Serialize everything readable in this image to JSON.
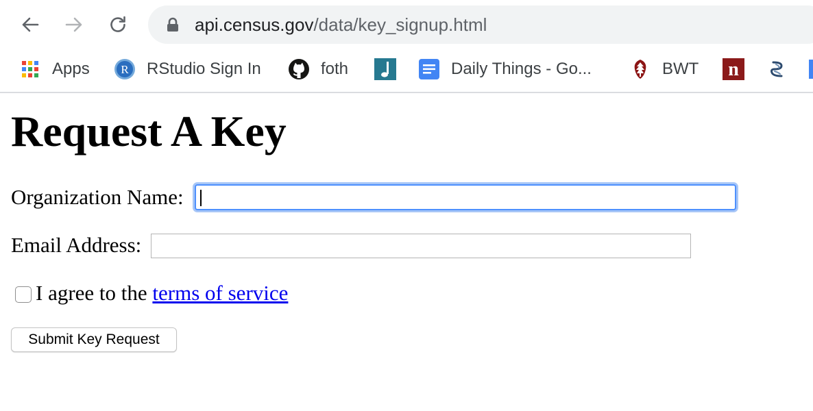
{
  "browser": {
    "url_host": "api.census.gov",
    "url_path": "/data/key_signup.html",
    "bookmarks": [
      {
        "label": "Apps",
        "icon": "apps-grid-icon"
      },
      {
        "label": "RStudio Sign In",
        "icon": "r-logo-icon"
      },
      {
        "label": "foth",
        "icon": "github-icon"
      },
      {
        "label": "",
        "icon": "music-note-icon"
      },
      {
        "label": "Daily Things - Go...",
        "icon": "google-docs-icon"
      },
      {
        "label": "BWT",
        "icon": "stanford-tree-icon"
      },
      {
        "label": "",
        "icon": "n-logo-icon"
      },
      {
        "label": "",
        "icon": "squiggle-icon"
      }
    ]
  },
  "page": {
    "title": "Request A Key",
    "org_label": "Organization Name:",
    "org_value": "",
    "email_label": "Email Address:",
    "email_value": "",
    "agree_prefix": "I agree to the ",
    "tos_link": "terms of service",
    "submit_label": "Submit Key Request"
  },
  "colors": {
    "link": "#0000ee",
    "focus_ring": "#4d90fe",
    "omnibox_bg": "#f1f3f4"
  }
}
